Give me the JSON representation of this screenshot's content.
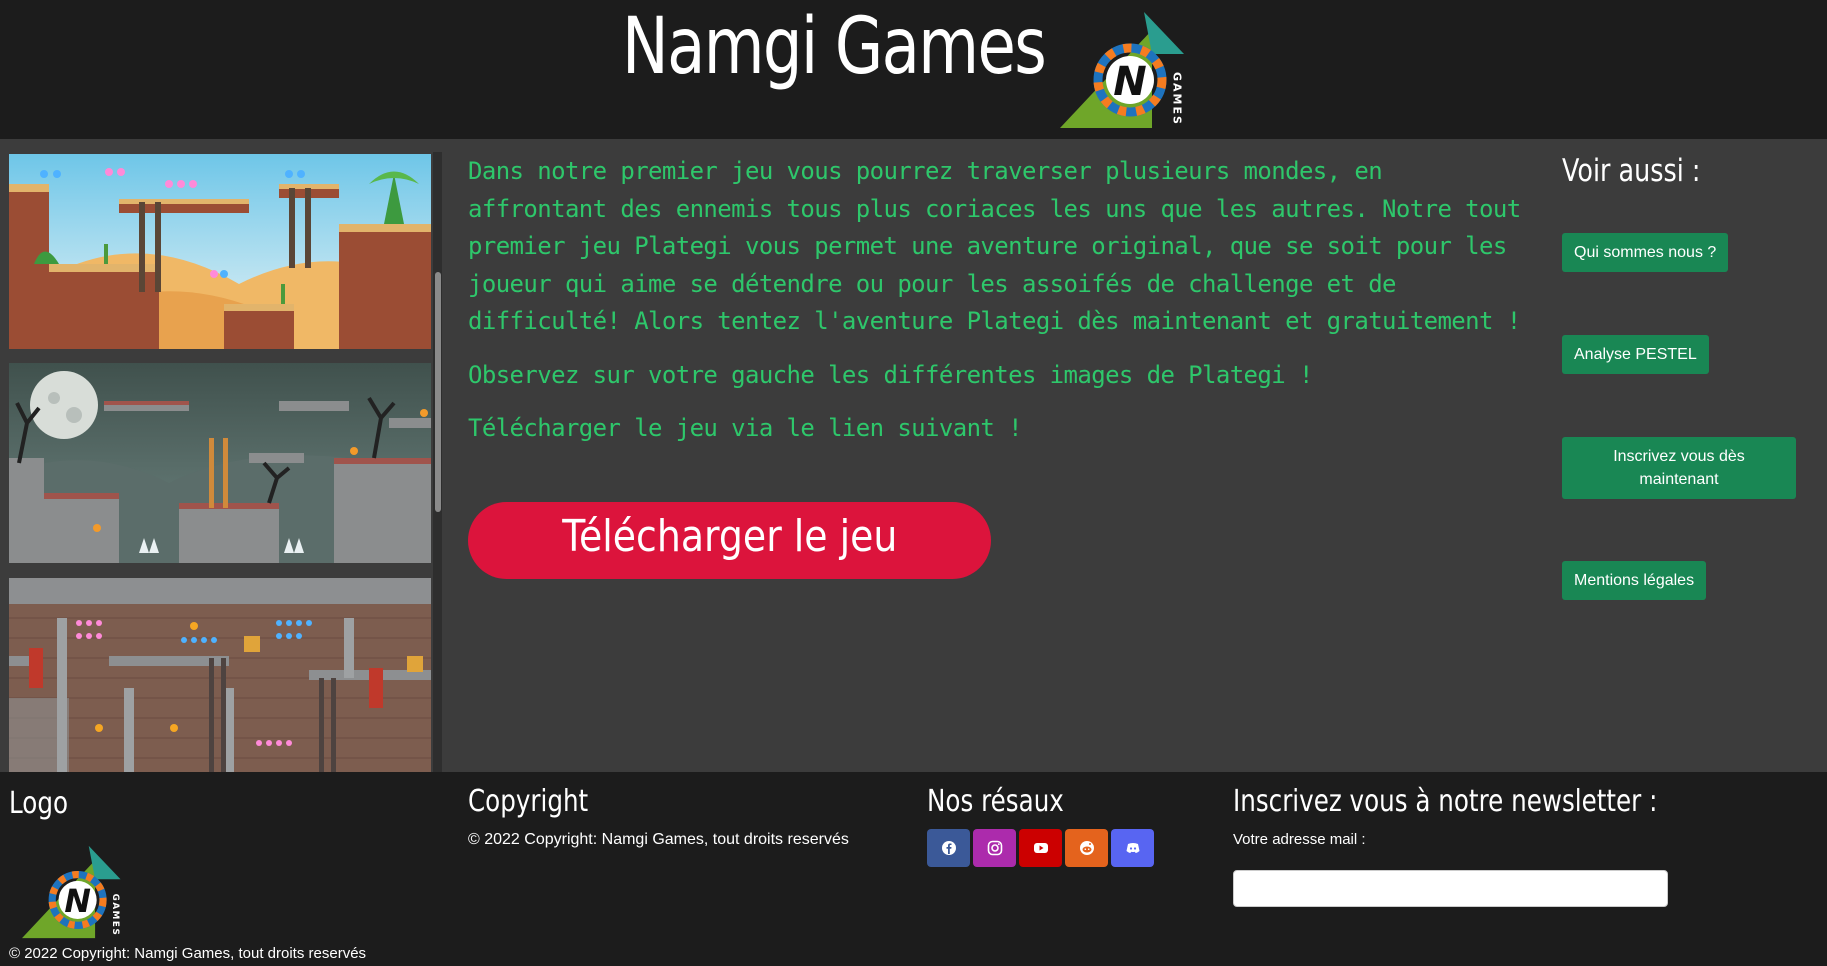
{
  "header": {
    "title": "Namgi Games",
    "logo": {
      "letter": "N",
      "side_text": "GAMES",
      "colors": {
        "triangle_green": "#6fa629",
        "triangle_teal": "#2a9d8f",
        "ring": "#1e73be",
        "ring_accent": "#f57c20"
      }
    }
  },
  "gallery": {
    "images": [
      {
        "theme": "desert-level"
      },
      {
        "theme": "haunted-night-level"
      },
      {
        "theme": "castle-dungeon-level"
      }
    ]
  },
  "main": {
    "paragraphs": [
      "Dans notre premier jeu vous pourrez traverser plusieurs mondes, en affrontant des ennemis tous plus coriaces les uns que les autres. Notre tout premier jeu Plategi vous permet une aventure original, que se soit pour les joueur qui aime se détendre ou pour les assoifés de challenge et de difficulté! Alors tentez l'aventure Plategi dès maintenant et gratuitement !",
      "Observez sur votre gauche les différentes images de Plategi !",
      "Télécharger le jeu via le lien suivant !"
    ],
    "download_label": "Télécharger le jeu",
    "text_color": "#2ec76b",
    "button_color": "#dc143c"
  },
  "aside": {
    "title": "Voir aussi :",
    "links": [
      {
        "label": "Qui sommes nous ?"
      },
      {
        "label": "Analyse PESTEL"
      },
      {
        "label": "Inscrivez vous dès maintenant"
      },
      {
        "label": "Mentions légales"
      }
    ],
    "button_color": "#198754"
  },
  "footer": {
    "logo_heading": "Logo",
    "copyright_heading": "Copyright",
    "copyright_text": "© 2022 Copyright: Namgi Games, tout droits reservés",
    "social_heading": "Nos résaux",
    "social": [
      {
        "name": "facebook-icon",
        "color": "#3b5998"
      },
      {
        "name": "instagram-icon",
        "color": "#ac2bac"
      },
      {
        "name": "youtube-icon",
        "color": "#cc0000"
      },
      {
        "name": "reddit-icon",
        "color": "#e4631d"
      },
      {
        "name": "discord-icon",
        "color": "#5865f2"
      }
    ],
    "newsletter_heading": "Inscrivez vous à notre newsletter :",
    "email_label": "Votre adresse mail :",
    "email_value": "",
    "bottom_copyright": "© 2022 Copyright: Namgi Games, tout droits reservés"
  }
}
